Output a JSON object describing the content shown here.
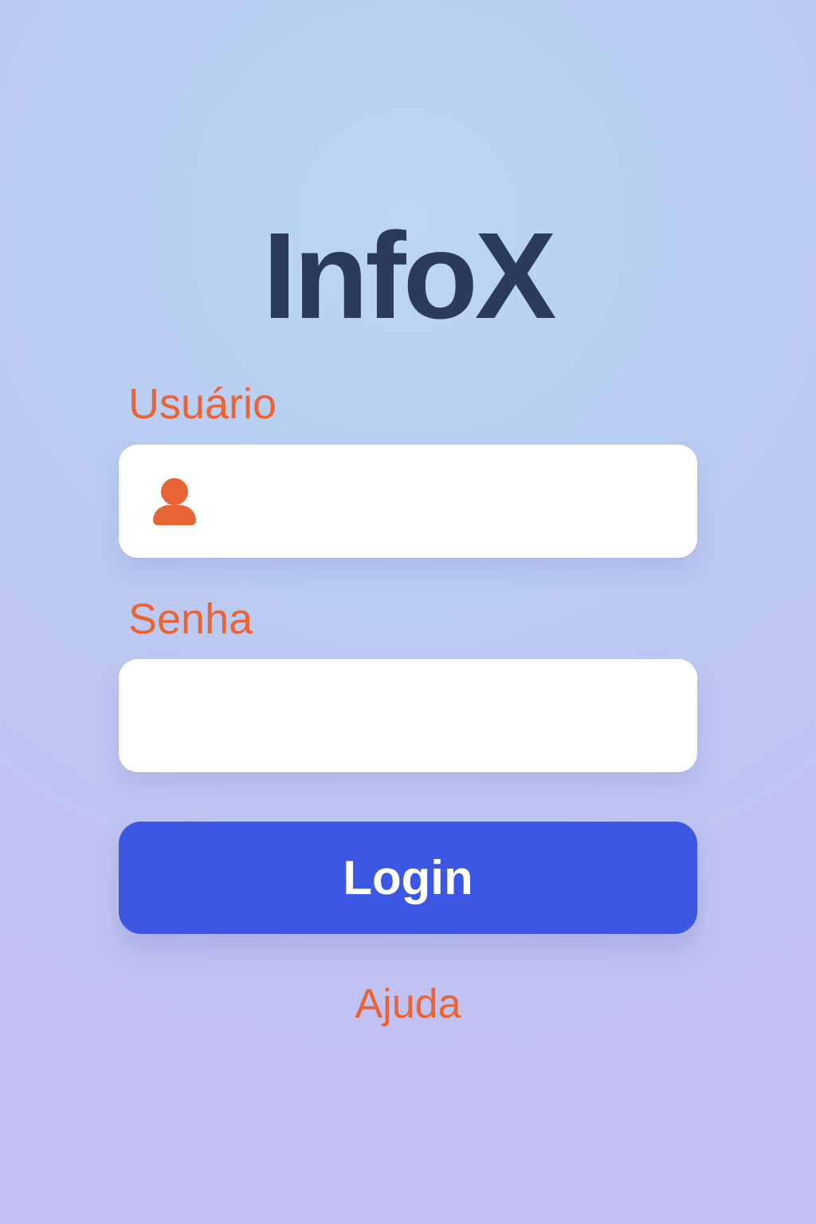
{
  "app": {
    "title": "InfoX"
  },
  "form": {
    "username": {
      "label": "Usuário",
      "value": "",
      "placeholder": "",
      "icon": "user-icon"
    },
    "password": {
      "label": "Senha",
      "value": "",
      "placeholder": ""
    },
    "login_label": "Login",
    "help_label": "Ajuda"
  },
  "colors": {
    "background_top": "#bcd6f5",
    "background_bottom": "#c4bff2",
    "title": "#2b3a5e",
    "accent": "#e86434",
    "button": "#3c58e2",
    "field": "#ffffff"
  }
}
